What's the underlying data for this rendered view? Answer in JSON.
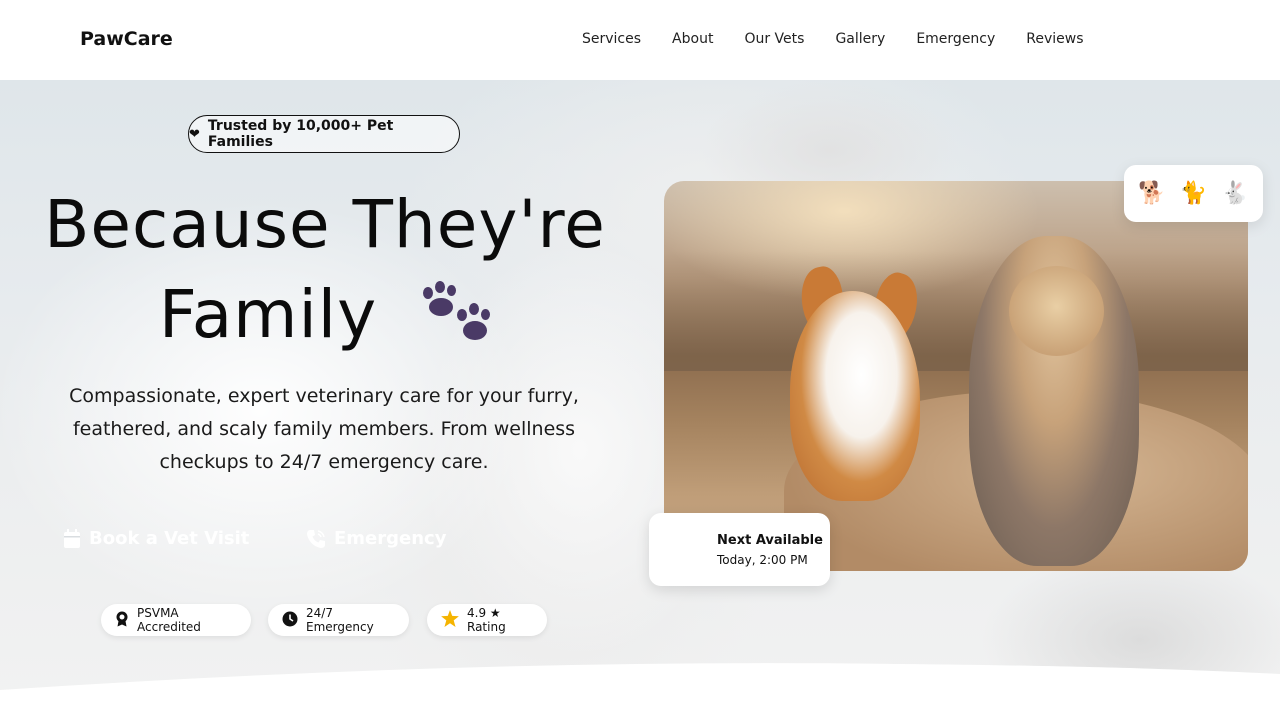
{
  "brand": {
    "logo": "PawCare"
  },
  "nav": {
    "items": [
      {
        "label": "Services"
      },
      {
        "label": "About"
      },
      {
        "label": "Our Vets"
      },
      {
        "label": "Gallery"
      },
      {
        "label": "Emergency"
      },
      {
        "label": "Reviews"
      }
    ]
  },
  "hero": {
    "badge": {
      "icon": "heart-icon",
      "text": "Trusted by 10,000+ Pet Families"
    },
    "headline_line1": "Because They're",
    "headline_line2": "Family",
    "headline_icon": "paw-prints-icon",
    "subtitle": "Compassionate, expert veterinary care for your furry, feathered, and scaly family members. From wellness checkups to 24/7 emergency care.",
    "cta_primary": {
      "label": "Book a Vet Visit",
      "icon": "calendar-icon"
    },
    "cta_secondary": {
      "label": "Emergency",
      "icon": "phone-icon"
    },
    "trust_pills": [
      {
        "label": "PSVMA Accredited",
        "icon": "award-icon"
      },
      {
        "label": "24/7 Emergency",
        "icon": "clock-icon"
      },
      {
        "label": "4.9 ★ Rating",
        "icon": "star-icon"
      }
    ]
  },
  "next_available": {
    "title": "Next Available",
    "time": "Today, 2:00 PM"
  },
  "pets_card": {
    "emojis": [
      "🐕",
      "🐈",
      "🐇"
    ]
  },
  "colors": {
    "text": "#111111",
    "paw": "#4a3a66",
    "star": "#f5b400",
    "cta_text": "#ffffff",
    "background": "#ffffff"
  }
}
